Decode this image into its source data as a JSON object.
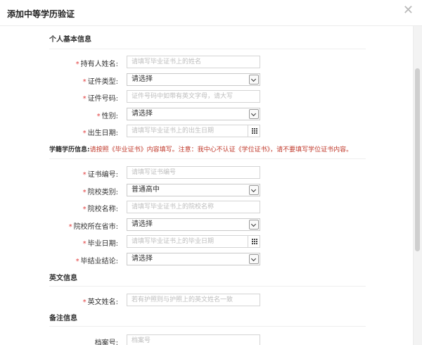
{
  "dialog": {
    "title": "添加中等学历验证",
    "close_glyph": "✕"
  },
  "sections": {
    "personal": "个人基本信息",
    "english": "英文信息",
    "remarks": "备注信息"
  },
  "notice": {
    "heading": "学籍学历信息:",
    "text": "请按照《毕业证书》内容填写。注意：我中心不认证《学位证书》，请不要填写学位证书内容。"
  },
  "fields": {
    "name": {
      "label": "持有人姓名:",
      "placeholder": "请填写毕业证书上的姓名",
      "required": true
    },
    "id_type": {
      "label": "证件类型:",
      "value": "请选择",
      "required": true
    },
    "id_number": {
      "label": "证件号码:",
      "placeholder": "证件号码中如带有英文字母，请大写",
      "required": true
    },
    "gender": {
      "label": "性别:",
      "value": "请选择",
      "required": true
    },
    "birth_date": {
      "label": "出生日期:",
      "placeholder": "请填写毕业证书上的出生日期",
      "required": true
    },
    "cert_number": {
      "label": "证书编号:",
      "placeholder": "请填写证书编号",
      "required": true
    },
    "school_type": {
      "label": "院校类别:",
      "value": "普通高中",
      "required": true
    },
    "school_name": {
      "label": "院校名称:",
      "placeholder": "请填写毕业证书上的院校名称",
      "required": true
    },
    "school_city": {
      "label": "院校所在省市:",
      "value": "请选择",
      "required": true
    },
    "grad_date": {
      "label": "毕业日期:",
      "placeholder": "请填写毕业证书上的毕业日期",
      "required": true
    },
    "grad_result": {
      "label": "毕结业结论:",
      "value": "请选择",
      "required": true
    },
    "english_name": {
      "label": "英文姓名:",
      "placeholder": "若有护照则与护照上的英文姓名一致",
      "required": true
    },
    "archive_number": {
      "label": "档案号:",
      "placeholder": "档案号",
      "required": false
    }
  },
  "required_mark": "*"
}
